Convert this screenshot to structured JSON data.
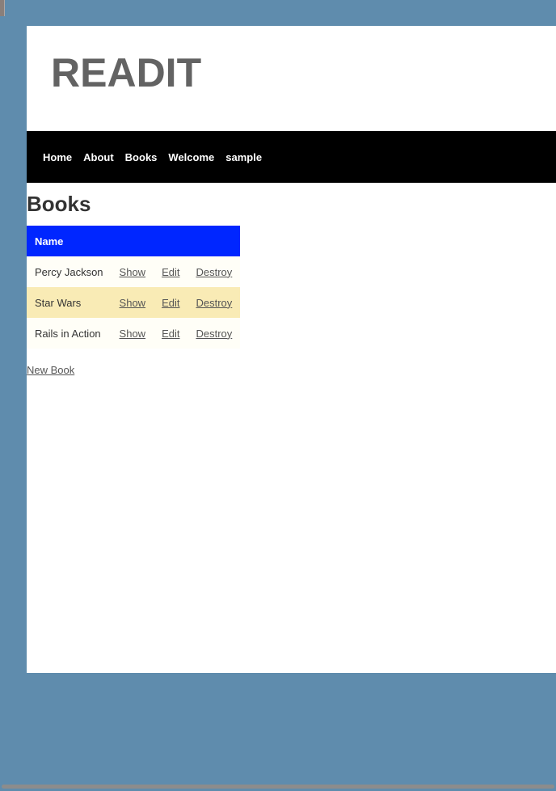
{
  "header": {
    "logo": "READIT"
  },
  "nav": {
    "items": [
      {
        "label": "Home"
      },
      {
        "label": "About"
      },
      {
        "label": "Books"
      },
      {
        "label": "Welcome"
      },
      {
        "label": "sample"
      }
    ]
  },
  "main": {
    "title": "Books",
    "table": {
      "headers": [
        "Name",
        "",
        "",
        ""
      ],
      "rows": [
        {
          "name": "Percy Jackson",
          "show": "Show",
          "edit": "Edit",
          "destroy": "Destroy"
        },
        {
          "name": "Star Wars",
          "show": "Show",
          "edit": "Edit",
          "destroy": "Destroy"
        },
        {
          "name": "Rails in Action",
          "show": "Show",
          "edit": "Edit",
          "destroy": "Destroy"
        }
      ]
    },
    "new_link": "New Book"
  },
  "colors": {
    "background": "#5f8cad",
    "navbar": "#000000",
    "table_header": "#0026ff",
    "row_odd": "#fffef7",
    "row_even": "#f9ebb5",
    "logo": "#636363"
  }
}
